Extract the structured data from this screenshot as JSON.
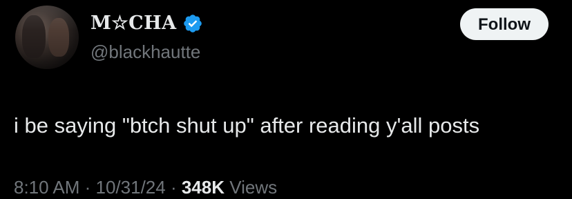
{
  "user": {
    "display_name": "M☆CHA",
    "handle": "@blackhautte",
    "verified": true
  },
  "follow_button": {
    "label": "Follow"
  },
  "tweet": {
    "text": "i be saying \"btch shut up\" after reading y'all posts",
    "time": "8:10 AM",
    "separator_1": " · ",
    "date": "10/31/24",
    "separator_2": " · ",
    "views_count": "348K",
    "views_label": " Views"
  },
  "colors": {
    "background": "#000000",
    "primary_text": "#e7e9ea",
    "secondary_text": "#71767b",
    "verified_badge": "#1d9bf0",
    "follow_button_bg": "#eff3f4"
  }
}
